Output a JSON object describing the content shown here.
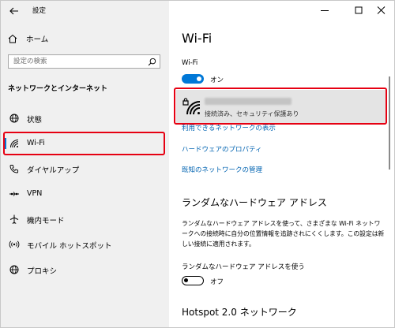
{
  "window": {
    "title": "設定",
    "min_glyph": "—",
    "max_glyph": "☐",
    "close_glyph": "✕"
  },
  "sidebar": {
    "home_label": "ホーム",
    "search_placeholder": "設定の検索",
    "section_title": "ネットワークとインターネット",
    "items": [
      {
        "label": "状態",
        "icon": "globe-icon"
      },
      {
        "label": "Wi-Fi",
        "icon": "wifi-icon",
        "active": true
      },
      {
        "label": "ダイヤルアップ",
        "icon": "phone-icon"
      },
      {
        "label": "VPN",
        "icon": "vpn-icon"
      },
      {
        "label": "機内モード",
        "icon": "airplane-icon"
      },
      {
        "label": "モバイル ホットスポット",
        "icon": "hotspot-icon"
      },
      {
        "label": "プロキシ",
        "icon": "globe-icon"
      }
    ]
  },
  "main": {
    "title": "Wi-Fi",
    "wifi_toggle": {
      "label": "Wi-Fi",
      "state": "オン",
      "on": true
    },
    "network": {
      "status": "接続済み、セキュリティ保護あり"
    },
    "links": [
      "利用できるネットワークの表示",
      "ハードウェアのプロパティ",
      "既知のネットワークの管理"
    ],
    "random_hw": {
      "heading": "ランダムなハードウェア アドレス",
      "description": "ランダムなハードウェア アドレスを使って、さまざまな Wi-Fi ネットワークへの接続時に自分の位置情報を追跡されにくくします。この設定は新しい接続に適用されます。",
      "toggle_label": "ランダムなハードウェア アドレスを使う",
      "toggle_state": "オフ",
      "on": false
    },
    "hotspot_heading": "Hotspot 2.0 ネットワーク"
  },
  "colors": {
    "accent": "#0078d7",
    "link": "#0063b1",
    "highlight": "#e60012",
    "sidebar_bg": "#f0f0f0",
    "card_bg": "#e4e4e4"
  }
}
